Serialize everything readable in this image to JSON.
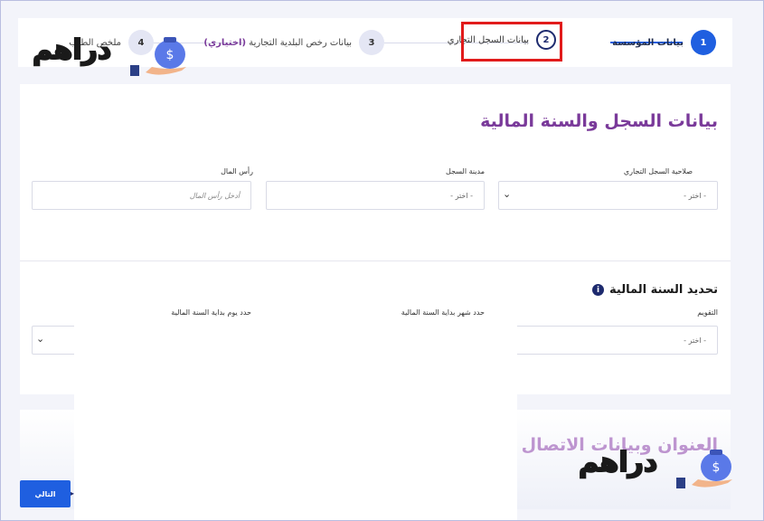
{
  "stepper": {
    "steps": [
      {
        "num": "1",
        "label": "بيانات المؤسسة"
      },
      {
        "num": "2",
        "label": "بيانات السجل التجاري"
      },
      {
        "num": "3",
        "label": "بيانات رخص البلدية التجارية",
        "optional": "(اختياري)"
      },
      {
        "num": "4",
        "label": "ملخص الطلب"
      }
    ]
  },
  "watermark": {
    "text": "دراهم"
  },
  "registry": {
    "title": "بيانات السجل والسنة المالية",
    "fields": [
      {
        "label": "صلاحية السجل التجاري",
        "value": "- اختر -"
      },
      {
        "label": "مدينة السجل",
        "value": "- اختر -"
      },
      {
        "label": "رأس المال",
        "placeholder": "أدخل رأس المال"
      }
    ]
  },
  "fiscal_year": {
    "title": "تحديد السنة المالية",
    "info_icon": "i",
    "fields": [
      {
        "label": "التقويم",
        "value": "- اختر -"
      },
      {
        "label": "حدد شهر بداية السنة المالية"
      },
      {
        "label": "حدد يوم بداية السنة المالية"
      }
    ]
  },
  "address": {
    "title": "العنوان وبيانات الاتصال"
  },
  "actions": {
    "next": "التالي",
    "arrow": "▸"
  },
  "colors": {
    "primary": "#1f5fe0",
    "title": "#7a3a9a",
    "highlight": "#e11b1b"
  }
}
